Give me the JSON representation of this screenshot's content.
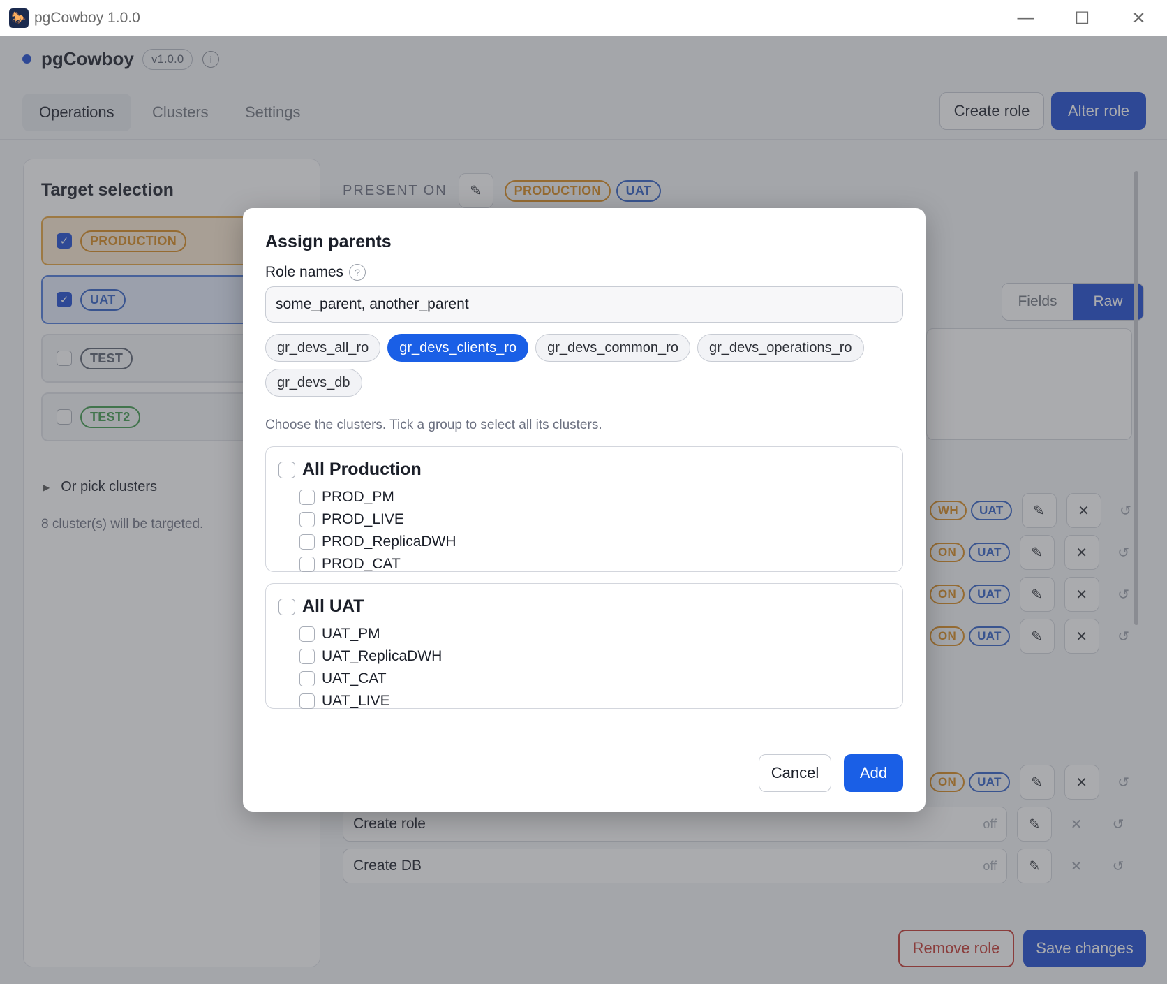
{
  "window": {
    "title": "pgCowboy 1.0.0",
    "minimize": "—",
    "maximize": "☐",
    "close": "✕"
  },
  "header": {
    "brand": "pgCowboy",
    "version": "v1.0.0",
    "info": "i"
  },
  "tabs": [
    {
      "label": "Operations"
    },
    {
      "label": "Clusters"
    },
    {
      "label": "Settings"
    }
  ],
  "actions": {
    "create_role": "Create role",
    "alter_role": "Alter role"
  },
  "target": {
    "title": "Target selection",
    "items": [
      {
        "label": "PRODUCTION",
        "checked": true
      },
      {
        "label": "UAT",
        "checked": true
      },
      {
        "label": "TEST",
        "checked": false
      },
      {
        "label": "TEST2",
        "checked": false
      }
    ],
    "pick_clusters": "Or pick clusters",
    "count_text": "8 cluster(s) will be targeted."
  },
  "present_on": {
    "label": "PRESENT ON",
    "tags": [
      "PRODUCTION",
      "UAT"
    ]
  },
  "view_toggle": {
    "fields": "Fields",
    "raw": "Raw"
  },
  "rows": [
    {
      "tag_partial": "WH",
      "tag": "UAT"
    },
    {
      "tag_partial": "ON",
      "tag": "UAT"
    },
    {
      "tag_partial": "ON",
      "tag": "UAT"
    },
    {
      "tag_partial": "ON",
      "tag": "UAT"
    },
    {
      "tag_partial": "ON",
      "tag": "UAT"
    }
  ],
  "fields": [
    {
      "label": "Create role",
      "value": "off"
    },
    {
      "label": "Create DB",
      "value": "off"
    }
  ],
  "footer": {
    "remove_role": "Remove role",
    "save_changes": "Save changes"
  },
  "modal": {
    "title": "Assign parents",
    "role_names_label": "Role names",
    "help": "?",
    "input_value": "some_parent, another_parent",
    "suggestions": [
      {
        "label": "gr_devs_all_ro",
        "selected": false
      },
      {
        "label": "gr_devs_clients_ro",
        "selected": true
      },
      {
        "label": "gr_devs_common_ro",
        "selected": false
      },
      {
        "label": "gr_devs_operations_ro",
        "selected": false
      },
      {
        "label": "gr_devs_db",
        "selected": false
      }
    ],
    "hint": "Choose the clusters. Tick a group to select all its clusters.",
    "groups": [
      {
        "title": "All Production",
        "clusters": [
          "PROD_PM",
          "PROD_LIVE",
          "PROD_ReplicaDWH",
          "PROD_CAT"
        ]
      },
      {
        "title": "All UAT",
        "clusters": [
          "UAT_PM",
          "UAT_ReplicaDWH",
          "UAT_CAT",
          "UAT_LIVE"
        ]
      }
    ],
    "cancel": "Cancel",
    "add": "Add"
  }
}
